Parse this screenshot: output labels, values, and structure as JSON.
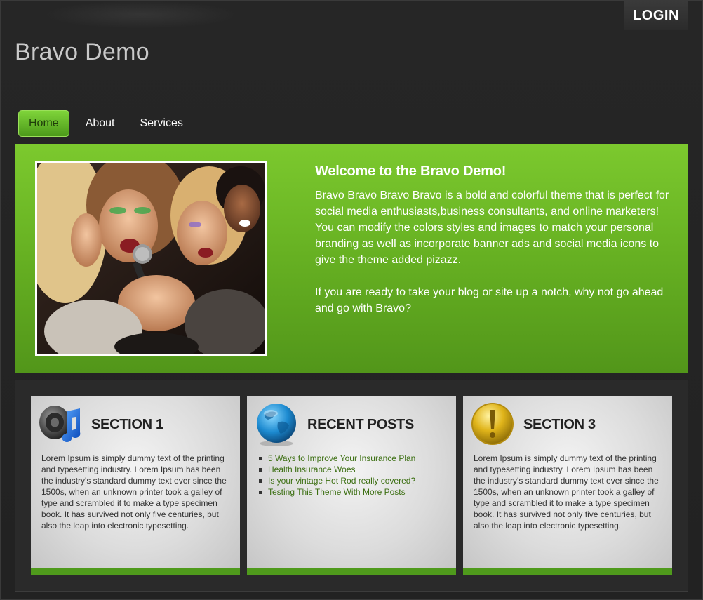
{
  "header": {
    "login_label": "LOGIN",
    "site_title": "Bravo Demo"
  },
  "nav": {
    "items": [
      {
        "label": "Home",
        "active": true
      },
      {
        "label": "About",
        "active": false
      },
      {
        "label": "Services",
        "active": false
      }
    ]
  },
  "hero": {
    "title": "Welcome to the Bravo Demo!",
    "paragraph_1": "Bravo Bravo Bravo Bravo is a bold and colorful theme that is perfect for social media enthusiasts,business consultants, and online marketers! You can modify the colors styles and images to match your personal branding as well as incorporate banner ads and social media icons to give the theme added pizazz.",
    "paragraph_2": "If you are ready to take your blog or site up a notch, why not go ahead and go with Bravo?",
    "image_icon": "karaoke-friends-photo"
  },
  "sections": [
    {
      "title": "SECTION 1",
      "icon": "speaker-music-note-icon",
      "body": "Lorem Ipsum is simply dummy text of the printing and typesetting industry. Lorem Ipsum has been the industry's standard dummy text ever since the 1500s, when an unknown printer took a galley of type and scrambled it to make a type specimen book. It has survived not only five centuries, but also the leap into electronic typesetting."
    },
    {
      "title": "RECENT POSTS",
      "icon": "globe-icon",
      "posts": [
        "5 Ways to Improve Your Insurance Plan",
        "Health Insurance Woes",
        "Is your vintage Hot Rod really covered?",
        "Testing This Theme With More Posts"
      ]
    },
    {
      "title": "SECTION 3",
      "icon": "exclamation-icon",
      "body": "Lorem Ipsum is simply dummy text of the printing and typesetting industry. Lorem Ipsum has been the industry's standard dummy text ever since the 1500s, when an unknown printer took a galley of type and scrambled it to make a type specimen book. It has survived not only five centuries, but also the leap into electronic typesetting."
    }
  ],
  "colors": {
    "background": "#232323",
    "accent_green": "#6bb524",
    "dark_green": "#4f9a1c",
    "link_green": "#3c6f12"
  }
}
